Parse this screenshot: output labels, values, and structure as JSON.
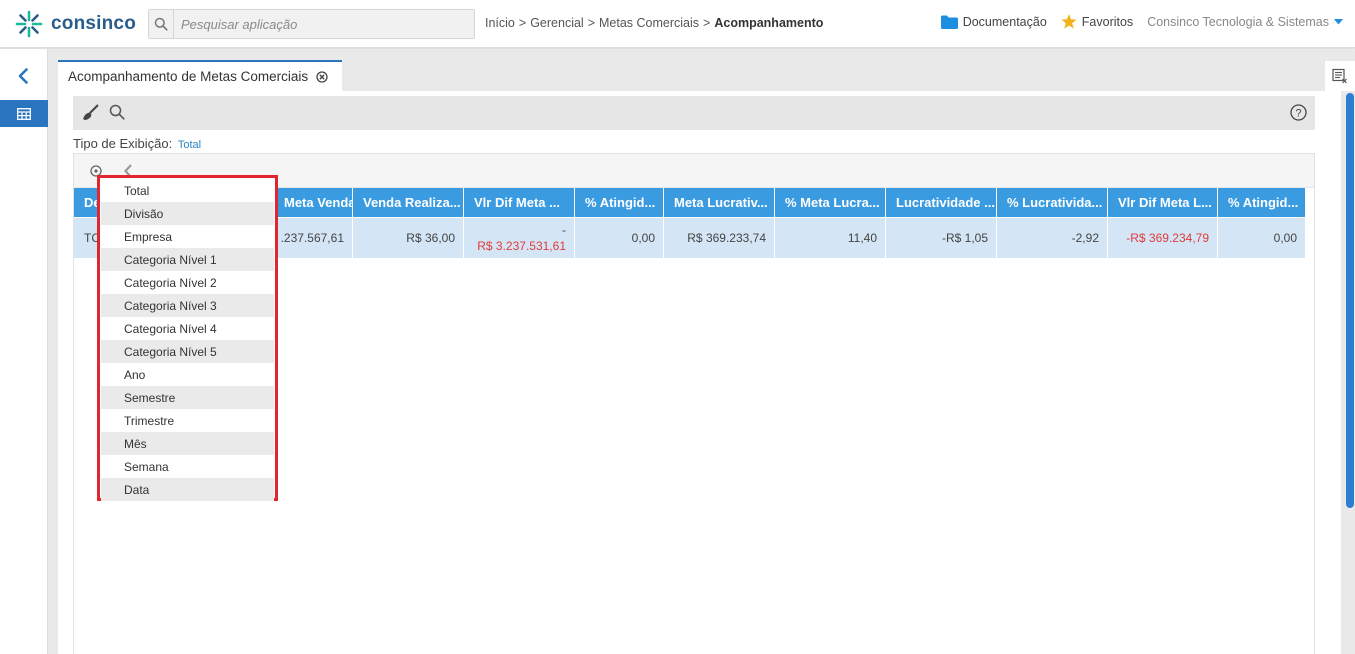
{
  "brand": {
    "name": "consinco",
    "accent": "#2b75c0",
    "logo_green": "#1eb89a"
  },
  "search": {
    "placeholder": "Pesquisar aplicação",
    "icon": "search-icon"
  },
  "breadcrumb": [
    "Início",
    ">",
    "Gerencial",
    ">",
    "Metas Comerciais",
    ">",
    "Acompanhamento"
  ],
  "header_links": {
    "documentacao": "Documentação",
    "favoritos": "Favoritos",
    "company": "Consinco Tecnologia & Sistemas"
  },
  "tab": {
    "title": "Acompanhamento de Metas Comerciais"
  },
  "filter": {
    "label": "Tipo de Exibição:",
    "value": "Total"
  },
  "table": {
    "columns": [
      "De",
      "Meta Venda",
      "Venda Realiza...",
      "Vlr Dif Meta ...",
      "% Atingid...",
      "Meta Lucrativ...",
      "% Meta Lucra...",
      "Lucratividade ...",
      "% Lucratividа...",
      "Vlr Dif Meta L...",
      "% Atingid..."
    ],
    "row": {
      "c0": "TC",
      "c1": ".237.567,61",
      "c2": "R$ 36,00",
      "c3_top": "-",
      "c3_bottom": "R$ 3.237.531,61",
      "c4": "0,00",
      "c5": "R$ 369.233,74",
      "c6": "11,40",
      "c7": "-R$ 1,05",
      "c8": "-2,92",
      "c9": "-R$ 369.234,79",
      "c10": "0,00"
    }
  },
  "dropdown": {
    "options": [
      "Total",
      "Divisão",
      "Empresa",
      "Categoria Nível 1",
      "Categoria Nível 2",
      "Categoria Nível 3",
      "Categoria Nível 4",
      "Categoria Nível 5",
      "Ano",
      "Semestre",
      "Trimestre",
      "Mês",
      "Semana",
      "Data"
    ]
  },
  "colors": {
    "header_blue": "#3b9be0",
    "row_blue": "#d4e6f5",
    "negative": "#e03b3b",
    "highlight_border": "#e0262f"
  }
}
